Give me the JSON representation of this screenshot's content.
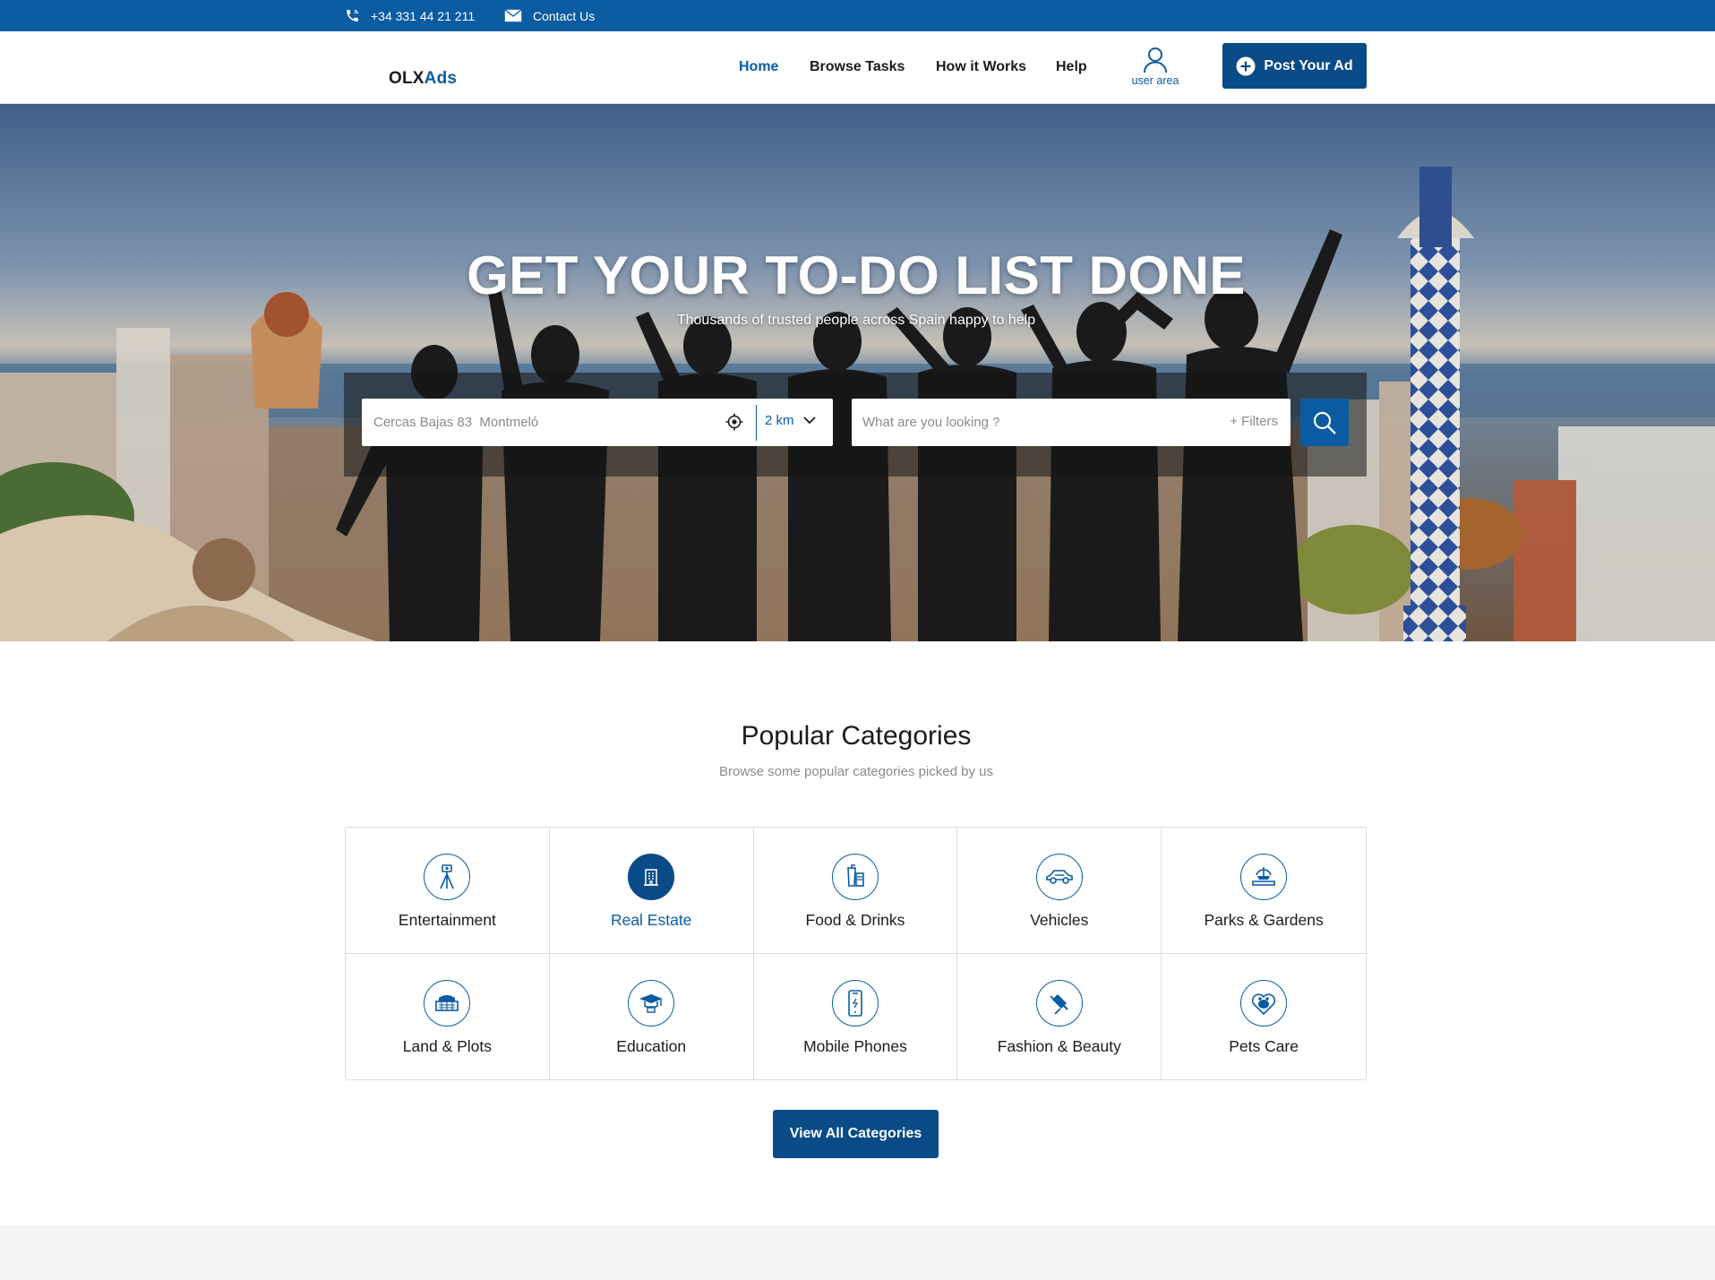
{
  "topbar": {
    "phone": "+34 331 44 21 211",
    "contact_label": "Contact Us",
    "background": "#0a5ba2"
  },
  "header": {
    "logo_primary": "OLX",
    "logo_accent": "Ads",
    "nav": [
      {
        "label": "Home",
        "active": true
      },
      {
        "label": "Browse Tasks",
        "active": false
      },
      {
        "label": "How it Works",
        "active": false
      },
      {
        "label": "Help",
        "active": false
      }
    ],
    "user_area_label": "user area",
    "post_button_label": "Post Your Ad"
  },
  "hero": {
    "title": "GET YOUR TO-DO LIST DONE",
    "subtitle": "Thousands of trusted people across Spain happy to help",
    "location_placeholder": "Cercas Bajas 83  Montmeló",
    "distance_value": "2 km",
    "query_placeholder": "What are you looking ?",
    "filters_label": "+ Filters"
  },
  "categories": {
    "title": "Popular Categories",
    "subtitle": "Browse some popular categories picked by us",
    "items": [
      {
        "label": "Entertainment",
        "icon": "tripod-camera-icon",
        "active": false
      },
      {
        "label": "Real Estate",
        "icon": "building-icon",
        "active": true
      },
      {
        "label": "Food & Drinks",
        "icon": "drinks-icon",
        "active": false
      },
      {
        "label": "Vehicles",
        "icon": "car-icon",
        "active": false
      },
      {
        "label": "Parks & Gardens",
        "icon": "fountain-icon",
        "active": false
      },
      {
        "label": "Land & Plots",
        "icon": "land-icon",
        "active": false
      },
      {
        "label": "Education",
        "icon": "graduation-cap-icon",
        "active": false
      },
      {
        "label": "Mobile Phones",
        "icon": "smartphone-icon",
        "active": false
      },
      {
        "label": "Fashion & Beauty",
        "icon": "lipstick-icon",
        "active": false
      },
      {
        "label": "Pets Care",
        "icon": "pet-heart-icon",
        "active": false
      }
    ],
    "view_all_label": "View All Categories"
  },
  "colors": {
    "brand": "#0a5ba2",
    "brand_dark": "#084b86",
    "text": "#1b1b1b",
    "muted": "#8a8a8a"
  }
}
